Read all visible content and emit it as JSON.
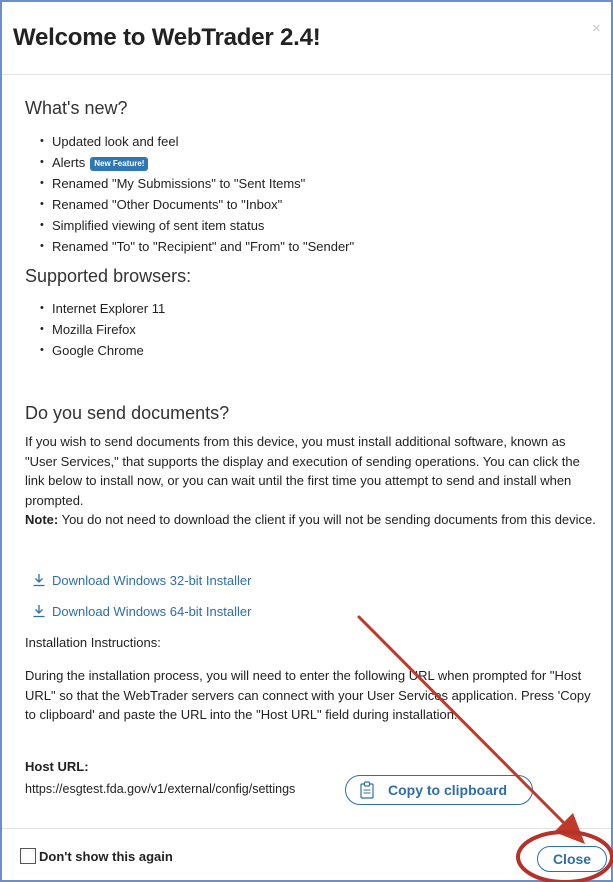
{
  "dialog": {
    "title": "Welcome to WebTrader 2.4!",
    "close_x": "×"
  },
  "whats_new": {
    "heading": "What's new?",
    "items": [
      "Updated look and feel",
      "Alerts",
      "Renamed \"My Submissions\" to \"Sent Items\"",
      "Renamed \"Other Documents\" to \"Inbox\"",
      "Simplified viewing of sent item status",
      "Renamed \"To\" to \"Recipient\" and \"From\" to \"Sender\""
    ],
    "badge": "New Feature!"
  },
  "browsers": {
    "heading": "Supported browsers:",
    "items": [
      "Internet Explorer 11",
      "Mozilla Firefox",
      "Google Chrome"
    ]
  },
  "send_docs": {
    "heading": "Do you send documents?",
    "paragraph": "If you wish to send documents from this device, you must install additional software, known as \"User Services,\" that supports the display and execution of sending operations. You can click the link below to install now, or you can wait until the first time you attempt to send and install when prompted.",
    "note_label": "Note:",
    "note_text": " You do not need to download the client if you will not be sending documents from this device."
  },
  "downloads": {
    "win32": "Download Windows 32-bit Installer",
    "win64": "Download Windows 64-bit Installer"
  },
  "install": {
    "heading": "Installation Instructions:",
    "paragraph": "During the installation process, you will need to enter the following URL when prompted for \"Host URL\" so that the WebTrader servers can connect with your User Services application. Press 'Copy to clipboard' and paste the URL into the \"Host URL\" field during installation.",
    "host_label": "Host URL:",
    "host_url": "https://esgtest.fda.gov/v1/external/config/settings",
    "copy_label": "Copy to clipboard"
  },
  "footer": {
    "dont_show": "Don't show this again",
    "close_label": "Close"
  },
  "colors": {
    "accent": "#2f6ea8",
    "badge": "#2f78b6",
    "annotation": "#c0392b",
    "border": "#6b8fc8"
  },
  "icons": {
    "download": "download-icon",
    "clipboard": "clipboard-icon",
    "close": "close-icon"
  }
}
